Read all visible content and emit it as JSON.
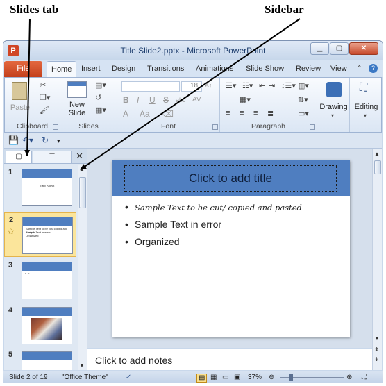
{
  "annotations": {
    "slides_tab": "Slides tab",
    "sidebar": "Sidebar"
  },
  "window": {
    "title": "Title Slide2.pptx - Microsoft PowerPoint",
    "app_letter": "P",
    "controls": {
      "minimize": "▁",
      "restore": "▢",
      "close": "✕"
    }
  },
  "tabs": {
    "file": "File",
    "items": [
      "Home",
      "Insert",
      "Design",
      "Transitions",
      "Animations",
      "Slide Show",
      "Review",
      "View"
    ],
    "active": "Home"
  },
  "ribbon": {
    "clipboard": {
      "label": "Clipboard",
      "paste": "Paste"
    },
    "slides": {
      "label": "Slides",
      "new_slide": "New Slide"
    },
    "font": {
      "label": "Font",
      "font_size": "18",
      "bold": "B",
      "italic": "I",
      "underline": "U",
      "strike": "S",
      "shadow": "abc",
      "spacing": "AV",
      "case": "Aa",
      "color": "A"
    },
    "paragraph": {
      "label": "Paragraph"
    },
    "drawing": {
      "label": "Drawing"
    },
    "editing": {
      "label": "Editing"
    }
  },
  "slides_pane": {
    "thumbnails": [
      {
        "num": "1",
        "title": "Title Slide"
      },
      {
        "num": "2",
        "lines": [
          "Sample Text to be cut/ copied and pasted",
          "Sample Text in error",
          "Organized"
        ]
      },
      {
        "num": "3",
        "lines": [
          "•",
          "•"
        ]
      },
      {
        "num": "4"
      },
      {
        "num": "5"
      }
    ],
    "selected": "2"
  },
  "slide": {
    "title_placeholder": "Click to add title",
    "bullets": [
      "Sample Text to be cut/ copied and pasted",
      "Sample Text in error",
      "Organized"
    ]
  },
  "notes_placeholder": "Click to add notes",
  "status": {
    "slide_counter": "Slide 2 of 19",
    "theme": "\"Office Theme\"",
    "zoom": "37%"
  }
}
